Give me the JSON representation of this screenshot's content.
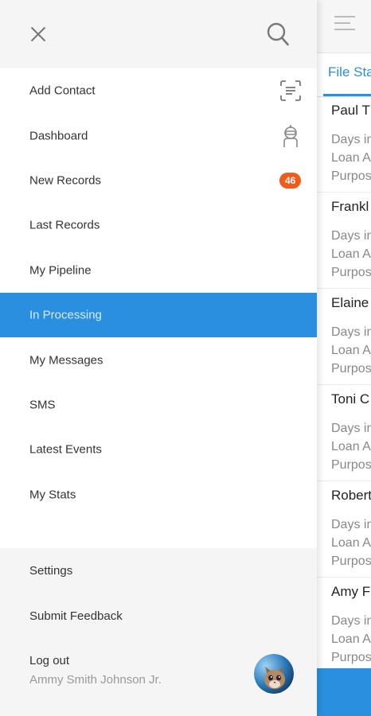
{
  "background": {
    "tab_label": "File Sta",
    "records": [
      {
        "name": "Paul T",
        "line1": "Days in",
        "line2": "Loan A",
        "line3": "Purpos"
      },
      {
        "name": "Frankl",
        "line1": "Days in",
        "line2": "Loan A",
        "line3": "Purpos"
      },
      {
        "name": "Elaine",
        "line1": "Days in",
        "line2": "Loan A",
        "line3": "Purpos"
      },
      {
        "name": "Toni C",
        "line1": "Days in",
        "line2": "Loan A",
        "line3": "Purpos"
      },
      {
        "name": "Robert",
        "line1": "Days in",
        "line2": "Loan A",
        "line3": "Purpos"
      },
      {
        "name": "Amy F",
        "line1": "Days in",
        "line2": "Loan A",
        "line3": "Purpos"
      }
    ]
  },
  "drawer": {
    "menu": [
      {
        "label": "Add Contact"
      },
      {
        "label": "Dashboard"
      },
      {
        "label": "New Records",
        "badge": "46"
      },
      {
        "label": "Last Records"
      },
      {
        "label": "My Pipeline"
      },
      {
        "label": "In Processing"
      },
      {
        "label": "My Messages"
      },
      {
        "label": "SMS"
      },
      {
        "label": "Latest Events"
      },
      {
        "label": "My Stats"
      }
    ],
    "settings_label": "Settings",
    "feedback_label": "Submit Feedback",
    "logout_label": "Log out",
    "user_name": "Ammy Smith Johnson Jr."
  },
  "colors": {
    "accent": "#2a8fde",
    "badge": "#f05a1a"
  }
}
